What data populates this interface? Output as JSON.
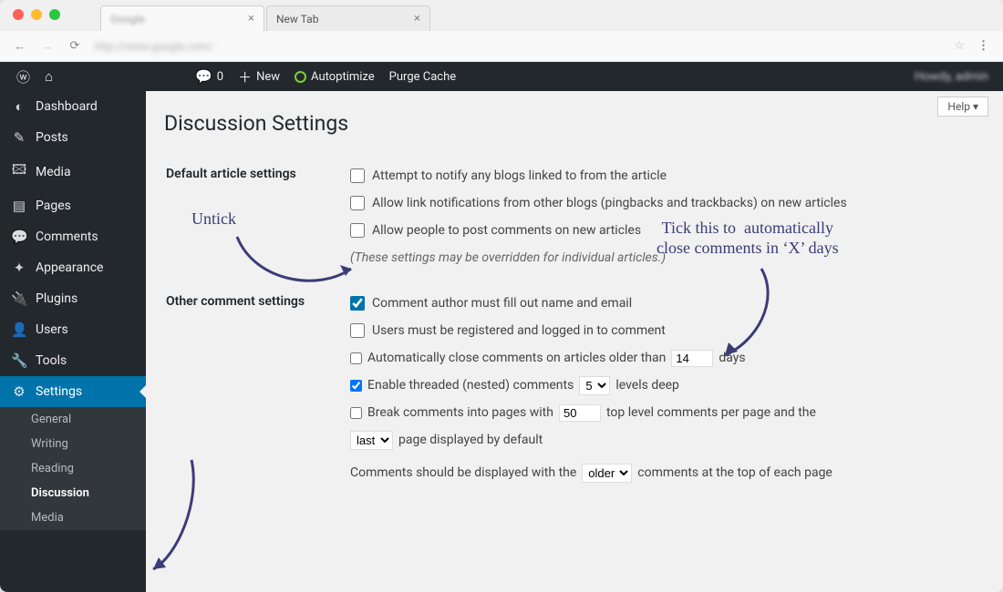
{
  "browser": {
    "tabs": [
      {
        "title_blurred": "Google",
        "closable": true
      },
      {
        "title": "New Tab",
        "closable": true
      }
    ],
    "url_blurred": "http://www.google.com/"
  },
  "adminbar": {
    "comment_count": "0",
    "new_label": "New",
    "autoptimize_label": "Autoptimize",
    "purge_label": "Purge Cache",
    "howdy_blurred": "Howdy, admin"
  },
  "sidebar": {
    "items": [
      {
        "icon": "◐",
        "label": "Dashboard"
      },
      {
        "icon": "✎",
        "label": "Posts"
      },
      {
        "icon": "🖾",
        "label": "Media"
      },
      {
        "icon": "▤",
        "label": "Pages"
      },
      {
        "icon": "💬",
        "label": "Comments"
      },
      {
        "icon": "✦",
        "label": "Appearance"
      },
      {
        "icon": "🔌",
        "label": "Plugins"
      },
      {
        "icon": "👤",
        "label": "Users"
      },
      {
        "icon": "🔧",
        "label": "Tools"
      },
      {
        "icon": "⚙",
        "label": "Settings"
      }
    ],
    "submenu": [
      "General",
      "Writing",
      "Reading",
      "Discussion",
      "Media"
    ]
  },
  "content": {
    "help_label": "Help ▾",
    "page_title": "Discussion Settings",
    "section1": {
      "heading": "Default article settings",
      "opts": [
        "Attempt to notify any blogs linked to from the article",
        "Allow link notifications from other blogs (pingbacks and trackbacks) on new articles",
        "Allow people to post comments on new articles"
      ],
      "note": "(These settings may be overridden for individual articles.)"
    },
    "section2": {
      "heading": "Other comment settings",
      "opt_author": "Comment author must fill out name and email",
      "opt_registered": "Users must be registered and logged in to comment",
      "opt_autoclose_pre": "Automatically close comments on articles older than",
      "opt_autoclose_val": "14",
      "opt_autoclose_post": "days",
      "opt_threaded_pre": "Enable threaded (nested) comments",
      "opt_threaded_val": "5",
      "opt_threaded_post": "levels deep",
      "opt_paginate_pre": "Break comments into pages with",
      "opt_paginate_val": "50",
      "opt_paginate_mid": "top level comments per page and the",
      "opt_paginate_sel": "last",
      "opt_paginate_post": "page displayed by default",
      "opt_order_pre": "Comments should be displayed with the",
      "opt_order_sel": "older",
      "opt_order_post": "comments at the top of each page"
    }
  },
  "annotations": {
    "untick": "Untick",
    "tick_close": "Tick this to  automatically\nclose comments in ‘X’ days"
  }
}
